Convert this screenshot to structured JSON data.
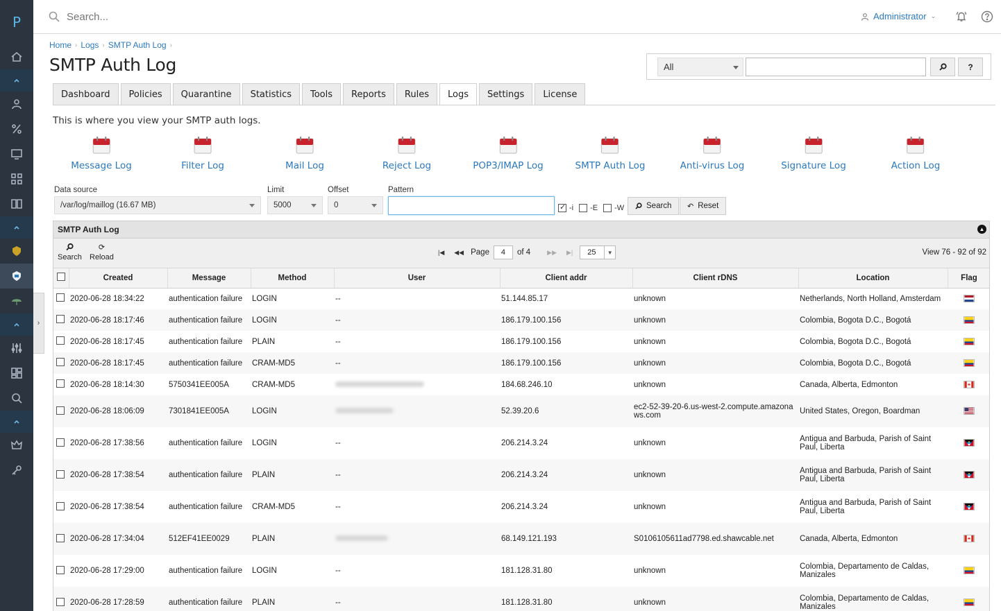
{
  "app": {
    "logo_letter": "P"
  },
  "topbar": {
    "search_placeholder": "Search...",
    "user": "Administrator"
  },
  "breadcrumb": [
    "Home",
    "Logs",
    "SMTP Auth Log"
  ],
  "page_title": "SMTP Auth Log",
  "global_search": {
    "scope": "All",
    "search_btn": "⌕",
    "help_btn": "?"
  },
  "tabs": [
    "Dashboard",
    "Policies",
    "Quarantine",
    "Statistics",
    "Tools",
    "Reports",
    "Rules",
    "Logs",
    "Settings",
    "License"
  ],
  "active_tab": "Logs",
  "intro": "This is where you view your SMTP auth logs.",
  "shortcuts": [
    "Message Log",
    "Filter Log",
    "Mail Log",
    "Reject Log",
    "POP3/IMAP Log",
    "SMTP Auth Log",
    "Anti-virus Log",
    "Signature Log",
    "Action Log"
  ],
  "filters": {
    "data_source_label": "Data source",
    "data_source_value": "/var/log/maillog (16.67 MB)",
    "limit_label": "Limit",
    "limit_value": "5000",
    "offset_label": "Offset",
    "offset_value": "0",
    "pattern_label": "Pattern",
    "pattern_value": "",
    "opt_i": "-i",
    "opt_e": "-E",
    "opt_w": "-W",
    "search_btn": "Search",
    "reset_btn": "Reset"
  },
  "grid": {
    "title": "SMTP Auth Log",
    "search_label": "Search",
    "reload_label": "Reload",
    "page_label": "Page",
    "page_value": "4",
    "page_of": "of 4",
    "page_size": "25",
    "view_info": "View 76 - 92 of 92",
    "columns": [
      "Created",
      "Message",
      "Method",
      "User",
      "Client addr",
      "Client rDNS",
      "Location",
      "Flag"
    ],
    "rows": [
      {
        "created": "2020-06-28 18:34:22",
        "message": "authentication failure",
        "method": "LOGIN",
        "user": "--",
        "addr": "51.144.85.17",
        "rdns": "unknown",
        "location": "Netherlands, North Holland, Amsterdam",
        "flag": "nl"
      },
      {
        "created": "2020-06-28 18:17:46",
        "message": "authentication failure",
        "method": "LOGIN",
        "user": "--",
        "addr": "186.179.100.156",
        "rdns": "unknown",
        "location": "Colombia, Bogota D.C., Bogotá",
        "flag": "co"
      },
      {
        "created": "2020-06-28 18:17:45",
        "message": "authentication failure",
        "method": "PLAIN",
        "user": "--",
        "addr": "186.179.100.156",
        "rdns": "unknown",
        "location": "Colombia, Bogota D.C., Bogotá",
        "flag": "co"
      },
      {
        "created": "2020-06-28 18:17:45",
        "message": "authentication failure",
        "method": "CRAM-MD5",
        "user": "--",
        "addr": "186.179.100.156",
        "rdns": "unknown",
        "location": "Colombia, Bogota D.C., Bogotá",
        "flag": "co"
      },
      {
        "created": "2020-06-28 18:14:30",
        "message": "5750341EE005A",
        "method": "CRAM-MD5",
        "user": "",
        "addr": "184.68.246.10",
        "rdns": "unknown",
        "location": "Canada, Alberta, Edmonton",
        "flag": "ca"
      },
      {
        "created": "2020-06-28 18:06:09",
        "message": "7301841EE005A",
        "method": "LOGIN",
        "user": "",
        "addr": "52.39.20.6",
        "rdns": "ec2-52-39-20-6.us-west-2.compute.amazonaws.com",
        "location": "United States, Oregon, Boardman",
        "flag": "us"
      },
      {
        "created": "2020-06-28 17:38:56",
        "message": "authentication failure",
        "method": "LOGIN",
        "user": "--",
        "addr": "206.214.3.24",
        "rdns": "unknown",
        "location": "Antigua and Barbuda, Parish of Saint Paul, Liberta",
        "flag": "ag"
      },
      {
        "created": "2020-06-28 17:38:54",
        "message": "authentication failure",
        "method": "PLAIN",
        "user": "--",
        "addr": "206.214.3.24",
        "rdns": "unknown",
        "location": "Antigua and Barbuda, Parish of Saint Paul, Liberta",
        "flag": "ag"
      },
      {
        "created": "2020-06-28 17:38:54",
        "message": "authentication failure",
        "method": "CRAM-MD5",
        "user": "--",
        "addr": "206.214.3.24",
        "rdns": "unknown",
        "location": "Antigua and Barbuda, Parish of Saint Paul, Liberta",
        "flag": "ag"
      },
      {
        "created": "2020-06-28 17:34:04",
        "message": "512EF41EE0029",
        "method": "PLAIN",
        "user": "",
        "addr": "68.149.121.193",
        "rdns": "S0106105611ad7798.ed.shawcable.net",
        "location": "Canada, Alberta, Edmonton",
        "flag": "ca"
      },
      {
        "created": "2020-06-28 17:29:00",
        "message": "authentication failure",
        "method": "LOGIN",
        "user": "--",
        "addr": "181.128.31.80",
        "rdns": "unknown",
        "location": "Colombia, Departamento de Caldas, Manizales",
        "flag": "co"
      },
      {
        "created": "2020-06-28 17:28:59",
        "message": "authentication failure",
        "method": "PLAIN",
        "user": "--",
        "addr": "181.128.31.80",
        "rdns": "unknown",
        "location": "Colombia, Departamento de Caldas, Manizales",
        "flag": "co"
      }
    ]
  }
}
